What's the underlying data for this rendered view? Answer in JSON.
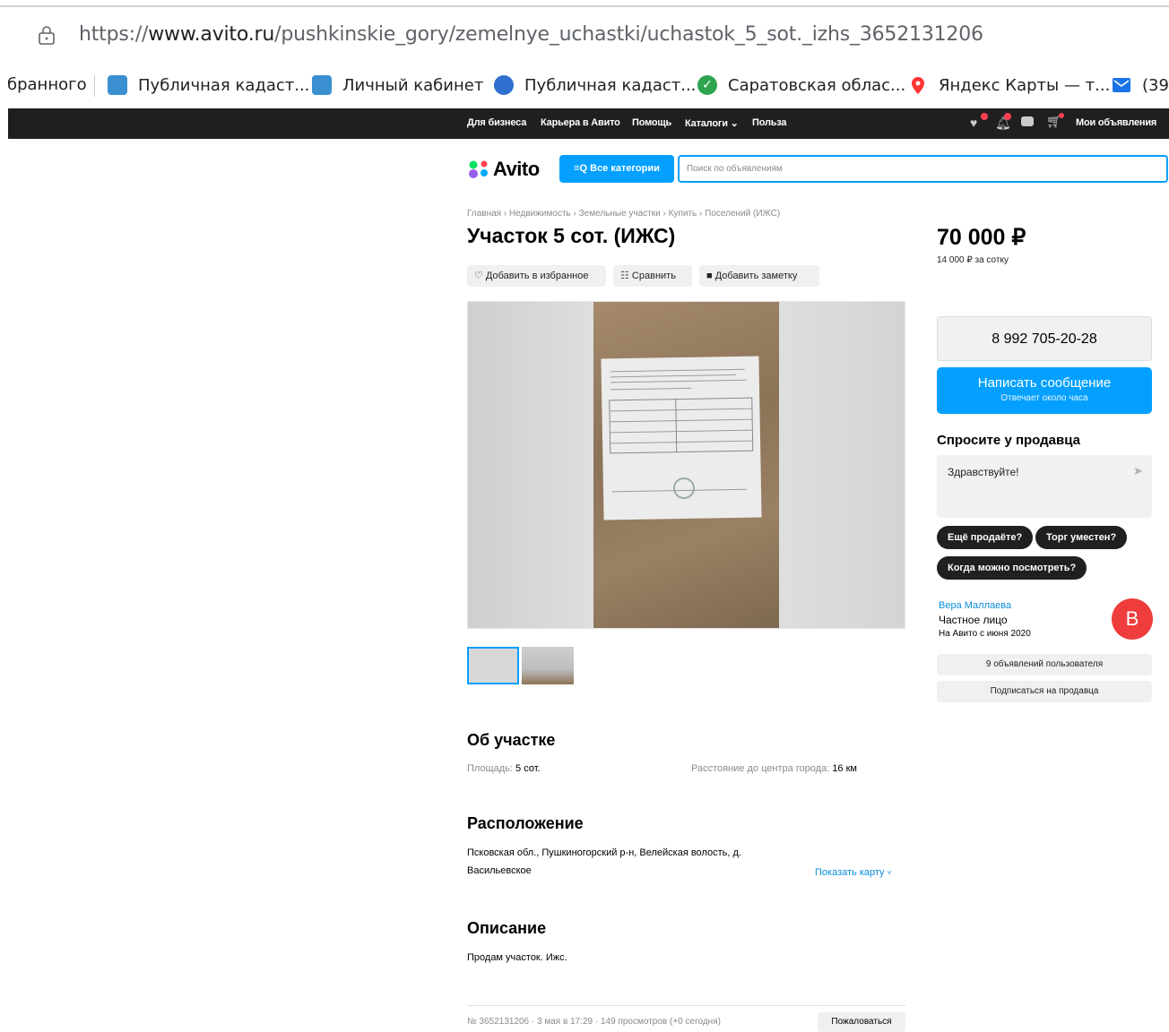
{
  "browser": {
    "url_prefix": "https://",
    "url_domain": "www.avito.ru",
    "url_path": "/pushkinskie_gory/zemelnye_uchastki/uchastok_5_sot._izhs_3652131206",
    "bookmarks": [
      {
        "label": "бранного",
        "icon": "none"
      },
      {
        "label": "Публичная кадаст...",
        "icon": "rosreestr-icon",
        "color": "#3a8fd1"
      },
      {
        "label": "Личный кабинет",
        "icon": "rosreestr-icon",
        "color": "#3a8fd1"
      },
      {
        "label": "Публичная кадаст...",
        "icon": "globe-house-icon",
        "color": "#2e6fd0"
      },
      {
        "label": "Саратовская облас...",
        "icon": "check-circle-icon",
        "color": "#2ea44f"
      },
      {
        "label": "Яндекс Карты — т...",
        "icon": "map-pin-icon",
        "color": "#f33"
      },
      {
        "label": "(39",
        "icon": "mail-icon",
        "color": "#1a73e8"
      }
    ]
  },
  "topbar": {
    "links": [
      "Для бизнеса",
      "Карьера в Авито",
      "Помощь",
      "Каталоги",
      "Польза"
    ],
    "my_ads": "Мои объявления"
  },
  "header": {
    "logo": "Avito",
    "categories_btn": "Все категории",
    "search_placeholder": "Поиск по объявлениям"
  },
  "listing": {
    "breadcrumb": "Главная › Недвижимость › Земельные участки › Купить › Поселений (ИЖС)",
    "title": "Участок 5 сот. (ИЖС)",
    "actions": {
      "favorite": "Добавить в избранное",
      "compare": "Сравнить",
      "note": "Добавить заметку"
    },
    "price": "70 000 ₽",
    "price_per": "14 000 ₽ за сотку"
  },
  "contact": {
    "phone": "8 992 705-20-28",
    "message_btn": "Написать сообщение",
    "message_sub": "Отвечает около часа",
    "ask_title": "Спросите у продавца",
    "ask_text": "Здравствуйте!",
    "chips": [
      "Ещё продаёте?",
      "Торг уместен?",
      "Когда можно посмотреть?"
    ]
  },
  "seller": {
    "name": "Вера Маллаева",
    "type": "Частное лицо",
    "since": "На Авито с июня 2020",
    "avatar_letter": "В",
    "avatar_color": "#ef3d3d",
    "ads_btn": "9 объявлений пользователя",
    "subscribe_btn": "Подписаться на продавца"
  },
  "about": {
    "title": "Об участке",
    "area_label": "Площадь:",
    "area_value": "5 сот.",
    "distance_label": "Расстояние до центра города:",
    "distance_value": "16 км"
  },
  "location": {
    "title": "Расположение",
    "line1": "Псковская обл., Пушкиногорский р-н, Велейская волость, д.",
    "line2": "Васильевское",
    "map_link": "Показать карту"
  },
  "description": {
    "title": "Описание",
    "text": "Продам участок. Ижс."
  },
  "footer": {
    "meta": "№ 3652131206 · 3 мая в 17:29 · 149 просмотров (+0 сегодня)",
    "complain": "Пожаловаться"
  },
  "colors": {
    "accent": "#04a0ff",
    "dark": "#1f1f1f",
    "link": "#0a8cda"
  }
}
